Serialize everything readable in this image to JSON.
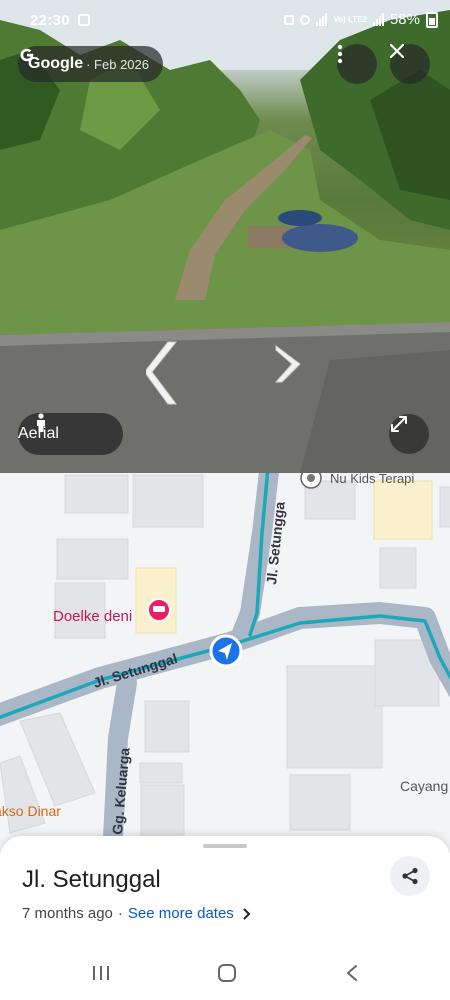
{
  "status_bar": {
    "time": "22:30",
    "network_label": "Vo) LTE2",
    "battery": "58%"
  },
  "street_view": {
    "brand": "Google",
    "date": "· Feb 2026",
    "more_icon": "more-vert-icon",
    "close_icon": "close-icon",
    "aerial_label": "Aerial",
    "aerial_icon": "pegman-icon",
    "expand_icon": "expand-icon"
  },
  "map": {
    "streets": [
      "Jl. Setunggal",
      "Jl. Setungga",
      "Gg. Keluarga"
    ],
    "pois": {
      "doelke": "Doelke deni",
      "nukids": "Nu Kids Terapi",
      "bakso": "akso Dinar",
      "cayang": "Cayang"
    },
    "colors": {
      "route": "#1ea7b8",
      "road": "#aab7c7",
      "hotel_pin": "#e91e63",
      "location": "#1a73e8"
    }
  },
  "sheet": {
    "title": "Jl. Setunggal",
    "age": "7 months ago",
    "separator": "·",
    "link": "See more dates",
    "share_icon": "share-icon"
  },
  "nav_bar": {
    "recents_icon": "recents-icon",
    "home_icon": "home-icon",
    "back_icon": "back-icon"
  }
}
